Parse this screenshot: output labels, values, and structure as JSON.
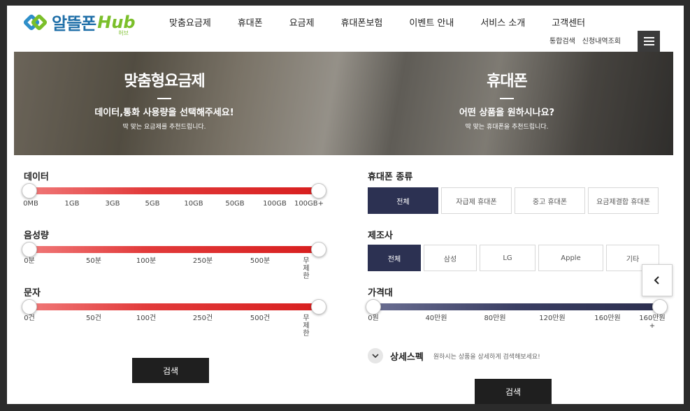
{
  "brand": {
    "logo_text": "알뜰폰",
    "logo_hub": "Hub",
    "logo_sub": "허브"
  },
  "nav": [
    "맞춤요금제",
    "휴대폰",
    "요금제",
    "휴대폰보험",
    "이벤트 안내",
    "서비스 소개",
    "고객센터"
  ],
  "util": [
    "통합검색",
    "신청내역조회"
  ],
  "banner": {
    "left": {
      "title": "맞춤형요금제",
      "sub": "데이터,통화 사용량을 선택해주세요!",
      "desc": "딱 맞는 요금제를 추천드립니다."
    },
    "right": {
      "title": "휴대폰",
      "sub": "어떤 상품을 원하시나요?",
      "desc": "딱 맞는 휴대폰을 추천드립니다."
    }
  },
  "filters": {
    "data": {
      "title": "데이터",
      "ticks": [
        "0MB",
        "1GB",
        "3GB",
        "5GB",
        "10GB",
        "50GB",
        "100GB",
        "100GB+"
      ],
      "range": [
        0,
        1
      ]
    },
    "voice": {
      "title": "음성량",
      "ticks": [
        "0분",
        "50분",
        "100분",
        "250분",
        "500분",
        "무제한"
      ],
      "range": [
        0,
        1
      ]
    },
    "sms": {
      "title": "문자",
      "ticks": [
        "0건",
        "50건",
        "100건",
        "250건",
        "500건",
        "무제한"
      ],
      "range": [
        0,
        1
      ]
    }
  },
  "left_search": "검색",
  "phone_type": {
    "title": "휴대폰 종류",
    "options": [
      "전체",
      "자급제 휴대폰",
      "중고 휴대폰",
      "요금제결합 휴대폰"
    ],
    "selected": "전체"
  },
  "maker": {
    "title": "제조사",
    "options": [
      "전체",
      "삼성",
      "LG",
      "Apple",
      "기타"
    ],
    "selected": "전체"
  },
  "price": {
    "title": "가격대",
    "ticks": [
      "0원",
      "40만원",
      "80만원",
      "120만원",
      "160만원",
      "160만원+"
    ],
    "range": [
      0,
      1
    ]
  },
  "detail": {
    "label": "상세스펙",
    "desc": "원하시는 상품을 상세하게 검색해보세요!"
  },
  "right_search": "검색",
  "colors": {
    "accent_red": "#e23b3b",
    "accent_navy": "#2c3152",
    "button_dark": "#1f1f1f"
  }
}
